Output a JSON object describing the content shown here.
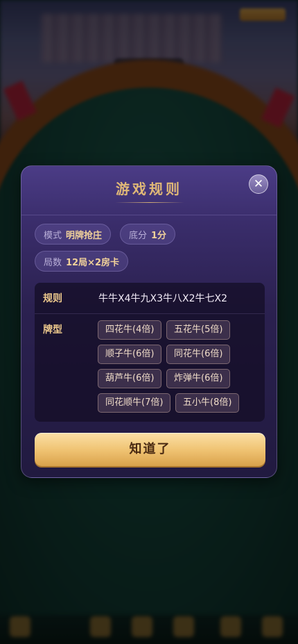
{
  "dialog": {
    "title": "游戏规则",
    "close_glyph": "✕",
    "settings": [
      {
        "label": "模式",
        "value": "明牌抢庄"
      },
      {
        "label": "底分",
        "value": "1分"
      },
      {
        "label": "局数",
        "value": "12局×2房卡"
      }
    ],
    "rules": {
      "label": "规则",
      "text": "牛牛X4牛九X3牛八X2牛七X2"
    },
    "hands": {
      "label": "牌型",
      "items": [
        "四花牛(4倍)",
        "五花牛(5倍)",
        "顺子牛(6倍)",
        "同花牛(6倍)",
        "葫芦牛(6倍)",
        "炸弹牛(6倍)",
        "同花顺牛(7倍)",
        "五小牛(8倍)"
      ]
    },
    "confirm_label": "知道了"
  },
  "colors": {
    "title": "#e0b877",
    "accent_gold": "#f0c474",
    "modal_bg": "#2b2150",
    "table_felt": "#164a3f"
  }
}
